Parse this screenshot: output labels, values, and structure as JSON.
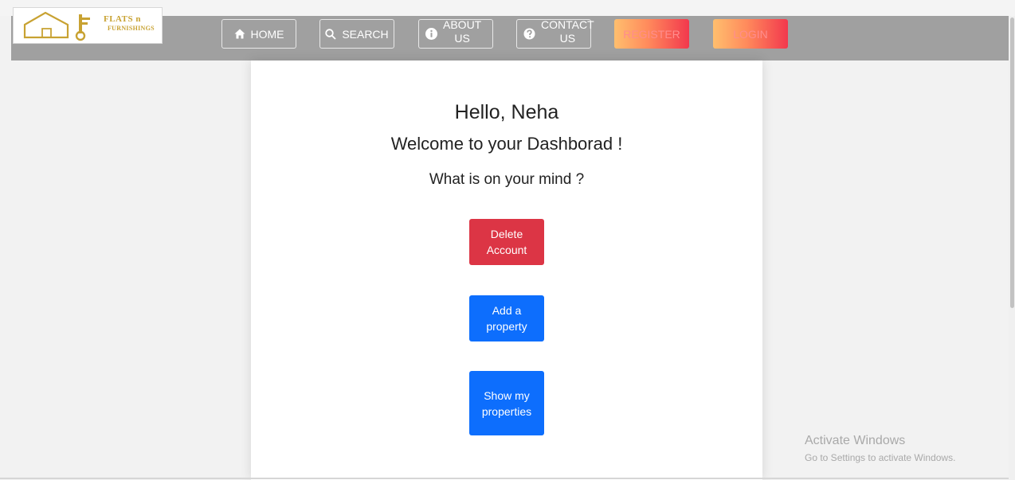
{
  "nav": {
    "logo_text_line1": "FLATS n",
    "logo_text_line2": "FURNISHINGS",
    "home_label": "HOME",
    "search_label": "SEARCH",
    "about_label_line1": "ABOUT",
    "about_label_line2": "US",
    "contact_label_line1": "CONTACT",
    "contact_label_line2": "US",
    "register_label": "REGISTER",
    "login_label": "LOGIN"
  },
  "dashboard": {
    "greeting": "Hello, Neha",
    "welcome": "Welcome to your Dashborad !",
    "question": "What is on your mind ?",
    "delete_button": "Delete Account",
    "add_button": "Add a property",
    "show_button": "Show my properties"
  },
  "watermark": {
    "line1": "Activate Windows",
    "line2": "Go to Settings to activate Windows."
  },
  "colors": {
    "navbar_bg": "#a0a0a0",
    "danger": "#dc3545",
    "primary": "#0d6efd",
    "logo_gold": "#c8a232",
    "gradient_start": "#ffbf6e",
    "gradient_end": "#f2384d"
  },
  "icons": {
    "home": "home-icon",
    "search": "search-icon",
    "about": "info-icon",
    "contact": "question-icon"
  }
}
